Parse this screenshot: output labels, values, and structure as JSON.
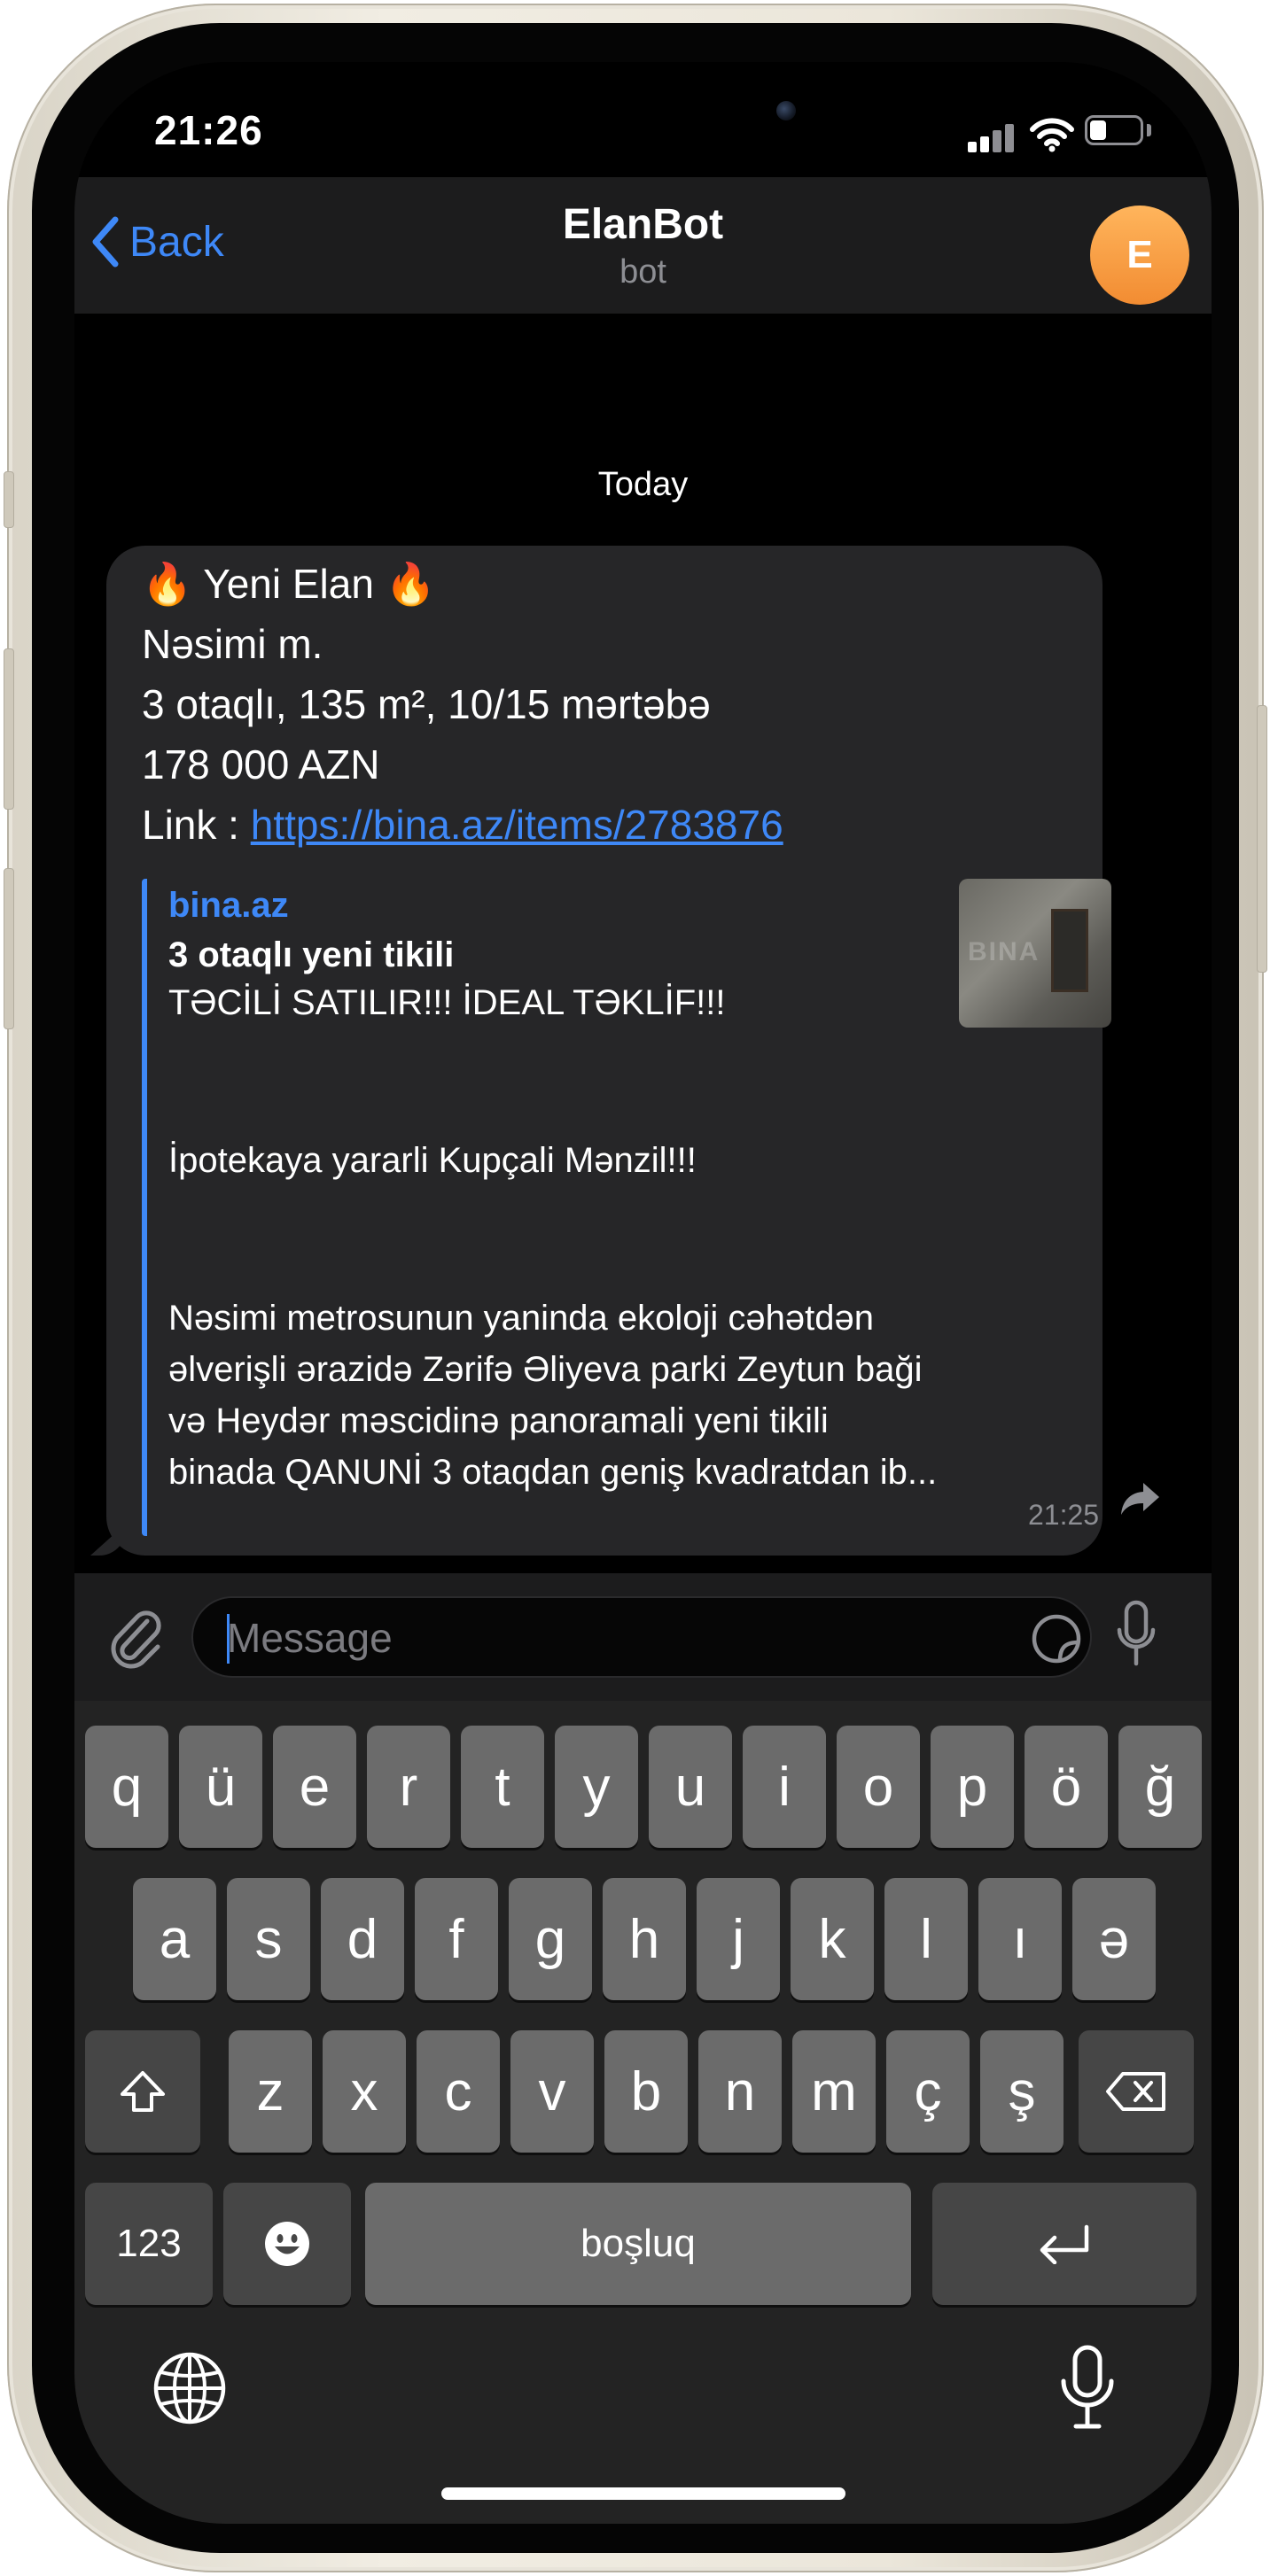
{
  "status_bar": {
    "time": "21:26"
  },
  "header": {
    "back_label": "Back",
    "title": "ElanBot",
    "subtitle": "bot",
    "avatar_initial": "E",
    "avatar_color": "#f5a04a",
    "accent_color": "#3e88f7"
  },
  "chat": {
    "date_separator": "Today",
    "message": {
      "headline_emoji": "🔥",
      "headline": "Yeni Elan",
      "lines": [
        "Nəsimi m.",
        "3 otaqlı, 135 m², 10/15 mərtəbə",
        "178 000 AZN"
      ],
      "link_prefix": "Link : ",
      "link_url": "https://bina.az/items/2783876",
      "time": "21:25",
      "preview": {
        "site": "bina.az",
        "title": "3 otaqlı yeni tikili",
        "lines": [
          "TƏCİLİ SATILIR!!!  İDEAL TƏKLİF!!!",
          "İpotekaya yararli Kupçali Mənzil!!!",
          "Nəsimi metrosunun yaninda ekoloji cəhətdən",
          "əlverişli ərazidə Zərifə Əliyeva parki Zeytun baği",
          "və Heydər məscidinə panoramali yeni tikili",
          "binada QANUNİ 3 otaqdan geniş kvadratdan ib..."
        ],
        "thumbnail_watermark": "BINA"
      }
    }
  },
  "composer": {
    "placeholder": "Message",
    "value": ""
  },
  "keyboard": {
    "row1": [
      "q",
      "ü",
      "e",
      "r",
      "t",
      "y",
      "u",
      "i",
      "o",
      "p",
      "ö",
      "ğ"
    ],
    "row2": [
      "a",
      "s",
      "d",
      "f",
      "g",
      "h",
      "j",
      "k",
      "l",
      "ı",
      "ə"
    ],
    "row3": [
      "z",
      "x",
      "c",
      "v",
      "b",
      "n",
      "m",
      "ç",
      "ş"
    ],
    "numbers_label": "123",
    "space_label": "boşluq"
  }
}
